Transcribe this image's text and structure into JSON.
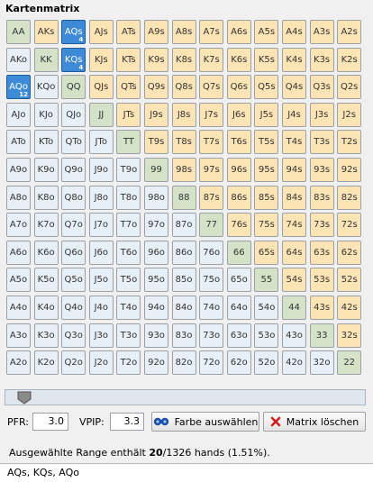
{
  "title": "Kartenmatrix",
  "matrix": {
    "rows": [
      [
        {
          "t": "AA",
          "k": "pair"
        },
        {
          "t": "AKs",
          "k": "suited"
        },
        {
          "t": "AQs",
          "k": "suited",
          "sel": true,
          "n": "4"
        },
        {
          "t": "AJs",
          "k": "suited"
        },
        {
          "t": "ATs",
          "k": "suited"
        },
        {
          "t": "A9s",
          "k": "suited"
        },
        {
          "t": "A8s",
          "k": "suited"
        },
        {
          "t": "A7s",
          "k": "suited"
        },
        {
          "t": "A6s",
          "k": "suited"
        },
        {
          "t": "A5s",
          "k": "suited"
        },
        {
          "t": "A4s",
          "k": "suited"
        },
        {
          "t": "A3s",
          "k": "suited"
        },
        {
          "t": "A2s",
          "k": "suited"
        }
      ],
      [
        {
          "t": "AKo",
          "k": "offsuit"
        },
        {
          "t": "KK",
          "k": "pair"
        },
        {
          "t": "KQs",
          "k": "suited",
          "sel": true,
          "n": "4"
        },
        {
          "t": "KJs",
          "k": "suited"
        },
        {
          "t": "KTs",
          "k": "suited"
        },
        {
          "t": "K9s",
          "k": "suited"
        },
        {
          "t": "K8s",
          "k": "suited"
        },
        {
          "t": "K7s",
          "k": "suited"
        },
        {
          "t": "K6s",
          "k": "suited"
        },
        {
          "t": "K5s",
          "k": "suited"
        },
        {
          "t": "K4s",
          "k": "suited"
        },
        {
          "t": "K3s",
          "k": "suited"
        },
        {
          "t": "K2s",
          "k": "suited"
        }
      ],
      [
        {
          "t": "AQo",
          "k": "offsuit",
          "sel": true,
          "n": "12"
        },
        {
          "t": "KQo",
          "k": "offsuit"
        },
        {
          "t": "QQ",
          "k": "pair"
        },
        {
          "t": "QJs",
          "k": "suited"
        },
        {
          "t": "QTs",
          "k": "suited"
        },
        {
          "t": "Q9s",
          "k": "suited"
        },
        {
          "t": "Q8s",
          "k": "suited"
        },
        {
          "t": "Q7s",
          "k": "suited"
        },
        {
          "t": "Q6s",
          "k": "suited"
        },
        {
          "t": "Q5s",
          "k": "suited"
        },
        {
          "t": "Q4s",
          "k": "suited"
        },
        {
          "t": "Q3s",
          "k": "suited"
        },
        {
          "t": "Q2s",
          "k": "suited"
        }
      ],
      [
        {
          "t": "AJo",
          "k": "offsuit"
        },
        {
          "t": "KJo",
          "k": "offsuit"
        },
        {
          "t": "QJo",
          "k": "offsuit"
        },
        {
          "t": "JJ",
          "k": "pair"
        },
        {
          "t": "JTs",
          "k": "suited"
        },
        {
          "t": "J9s",
          "k": "suited"
        },
        {
          "t": "J8s",
          "k": "suited"
        },
        {
          "t": "J7s",
          "k": "suited"
        },
        {
          "t": "J6s",
          "k": "suited"
        },
        {
          "t": "J5s",
          "k": "suited"
        },
        {
          "t": "J4s",
          "k": "suited"
        },
        {
          "t": "J3s",
          "k": "suited"
        },
        {
          "t": "J2s",
          "k": "suited"
        }
      ],
      [
        {
          "t": "ATo",
          "k": "offsuit"
        },
        {
          "t": "KTo",
          "k": "offsuit"
        },
        {
          "t": "QTo",
          "k": "offsuit"
        },
        {
          "t": "JTo",
          "k": "offsuit"
        },
        {
          "t": "TT",
          "k": "pair"
        },
        {
          "t": "T9s",
          "k": "suited"
        },
        {
          "t": "T8s",
          "k": "suited"
        },
        {
          "t": "T7s",
          "k": "suited"
        },
        {
          "t": "T6s",
          "k": "suited"
        },
        {
          "t": "T5s",
          "k": "suited"
        },
        {
          "t": "T4s",
          "k": "suited"
        },
        {
          "t": "T3s",
          "k": "suited"
        },
        {
          "t": "T2s",
          "k": "suited"
        }
      ],
      [
        {
          "t": "A9o",
          "k": "offsuit"
        },
        {
          "t": "K9o",
          "k": "offsuit"
        },
        {
          "t": "Q9o",
          "k": "offsuit"
        },
        {
          "t": "J9o",
          "k": "offsuit"
        },
        {
          "t": "T9o",
          "k": "offsuit"
        },
        {
          "t": "99",
          "k": "pair"
        },
        {
          "t": "98s",
          "k": "suited"
        },
        {
          "t": "97s",
          "k": "suited"
        },
        {
          "t": "96s",
          "k": "suited"
        },
        {
          "t": "95s",
          "k": "suited"
        },
        {
          "t": "94s",
          "k": "suited"
        },
        {
          "t": "93s",
          "k": "suited"
        },
        {
          "t": "92s",
          "k": "suited"
        }
      ],
      [
        {
          "t": "A8o",
          "k": "offsuit"
        },
        {
          "t": "K8o",
          "k": "offsuit"
        },
        {
          "t": "Q8o",
          "k": "offsuit"
        },
        {
          "t": "J8o",
          "k": "offsuit"
        },
        {
          "t": "T8o",
          "k": "offsuit"
        },
        {
          "t": "98o",
          "k": "offsuit"
        },
        {
          "t": "88",
          "k": "pair"
        },
        {
          "t": "87s",
          "k": "suited"
        },
        {
          "t": "86s",
          "k": "suited"
        },
        {
          "t": "85s",
          "k": "suited"
        },
        {
          "t": "84s",
          "k": "suited"
        },
        {
          "t": "83s",
          "k": "suited"
        },
        {
          "t": "82s",
          "k": "suited"
        }
      ],
      [
        {
          "t": "A7o",
          "k": "offsuit"
        },
        {
          "t": "K7o",
          "k": "offsuit"
        },
        {
          "t": "Q7o",
          "k": "offsuit"
        },
        {
          "t": "J7o",
          "k": "offsuit"
        },
        {
          "t": "T7o",
          "k": "offsuit"
        },
        {
          "t": "97o",
          "k": "offsuit"
        },
        {
          "t": "87o",
          "k": "offsuit"
        },
        {
          "t": "77",
          "k": "pair"
        },
        {
          "t": "76s",
          "k": "suited"
        },
        {
          "t": "75s",
          "k": "suited"
        },
        {
          "t": "74s",
          "k": "suited"
        },
        {
          "t": "73s",
          "k": "suited"
        },
        {
          "t": "72s",
          "k": "suited"
        }
      ],
      [
        {
          "t": "A6o",
          "k": "offsuit"
        },
        {
          "t": "K6o",
          "k": "offsuit"
        },
        {
          "t": "Q6o",
          "k": "offsuit"
        },
        {
          "t": "J6o",
          "k": "offsuit"
        },
        {
          "t": "T6o",
          "k": "offsuit"
        },
        {
          "t": "96o",
          "k": "offsuit"
        },
        {
          "t": "86o",
          "k": "offsuit"
        },
        {
          "t": "76o",
          "k": "offsuit"
        },
        {
          "t": "66",
          "k": "pair"
        },
        {
          "t": "65s",
          "k": "suited"
        },
        {
          "t": "64s",
          "k": "suited"
        },
        {
          "t": "63s",
          "k": "suited"
        },
        {
          "t": "62s",
          "k": "suited"
        }
      ],
      [
        {
          "t": "A5o",
          "k": "offsuit"
        },
        {
          "t": "K5o",
          "k": "offsuit"
        },
        {
          "t": "Q5o",
          "k": "offsuit"
        },
        {
          "t": "J5o",
          "k": "offsuit"
        },
        {
          "t": "T5o",
          "k": "offsuit"
        },
        {
          "t": "95o",
          "k": "offsuit"
        },
        {
          "t": "85o",
          "k": "offsuit"
        },
        {
          "t": "75o",
          "k": "offsuit"
        },
        {
          "t": "65o",
          "k": "offsuit"
        },
        {
          "t": "55",
          "k": "pair"
        },
        {
          "t": "54s",
          "k": "suited"
        },
        {
          "t": "53s",
          "k": "suited"
        },
        {
          "t": "52s",
          "k": "suited"
        }
      ],
      [
        {
          "t": "A4o",
          "k": "offsuit"
        },
        {
          "t": "K4o",
          "k": "offsuit"
        },
        {
          "t": "Q4o",
          "k": "offsuit"
        },
        {
          "t": "J4o",
          "k": "offsuit"
        },
        {
          "t": "T4o",
          "k": "offsuit"
        },
        {
          "t": "94o",
          "k": "offsuit"
        },
        {
          "t": "84o",
          "k": "offsuit"
        },
        {
          "t": "74o",
          "k": "offsuit"
        },
        {
          "t": "64o",
          "k": "offsuit"
        },
        {
          "t": "54o",
          "k": "offsuit"
        },
        {
          "t": "44",
          "k": "pair"
        },
        {
          "t": "43s",
          "k": "suited"
        },
        {
          "t": "42s",
          "k": "suited"
        }
      ],
      [
        {
          "t": "A3o",
          "k": "offsuit"
        },
        {
          "t": "K3o",
          "k": "offsuit"
        },
        {
          "t": "Q3o",
          "k": "offsuit"
        },
        {
          "t": "J3o",
          "k": "offsuit"
        },
        {
          "t": "T3o",
          "k": "offsuit"
        },
        {
          "t": "93o",
          "k": "offsuit"
        },
        {
          "t": "83o",
          "k": "offsuit"
        },
        {
          "t": "73o",
          "k": "offsuit"
        },
        {
          "t": "63o",
          "k": "offsuit"
        },
        {
          "t": "53o",
          "k": "offsuit"
        },
        {
          "t": "43o",
          "k": "offsuit"
        },
        {
          "t": "33",
          "k": "pair"
        },
        {
          "t": "32s",
          "k": "suited"
        }
      ],
      [
        {
          "t": "A2o",
          "k": "offsuit"
        },
        {
          "t": "K2o",
          "k": "offsuit"
        },
        {
          "t": "Q2o",
          "k": "offsuit"
        },
        {
          "t": "J2o",
          "k": "offsuit"
        },
        {
          "t": "T2o",
          "k": "offsuit"
        },
        {
          "t": "92o",
          "k": "offsuit"
        },
        {
          "t": "82o",
          "k": "offsuit"
        },
        {
          "t": "72o",
          "k": "offsuit"
        },
        {
          "t": "62o",
          "k": "offsuit"
        },
        {
          "t": "52o",
          "k": "offsuit"
        },
        {
          "t": "42o",
          "k": "offsuit"
        },
        {
          "t": "32o",
          "k": "offsuit"
        },
        {
          "t": "22",
          "k": "pair"
        }
      ]
    ]
  },
  "slider": {
    "value_fraction": 0.0
  },
  "controls": {
    "pfr_label": "PFR:",
    "pfr_value": "3.0",
    "vpip_label": "VPIP:",
    "vpip_value": "3.3",
    "color_button": "Farbe auswählen",
    "color_button_icon": "color-picker-icon",
    "clear_button": "Matrix löschen",
    "clear_button_icon": "red-x-icon"
  },
  "status": {
    "prefix": "Ausgewählte Range enthält ",
    "count": "20",
    "suffix": "/1326 hands (1.51%)."
  },
  "output": {
    "text": "AQs, KQs, AQo"
  },
  "colors": {
    "pair": "#d4e3c8",
    "suited": "#fde4b5",
    "offsuit": "#e7eff7",
    "selected": "#3d8bd8"
  }
}
